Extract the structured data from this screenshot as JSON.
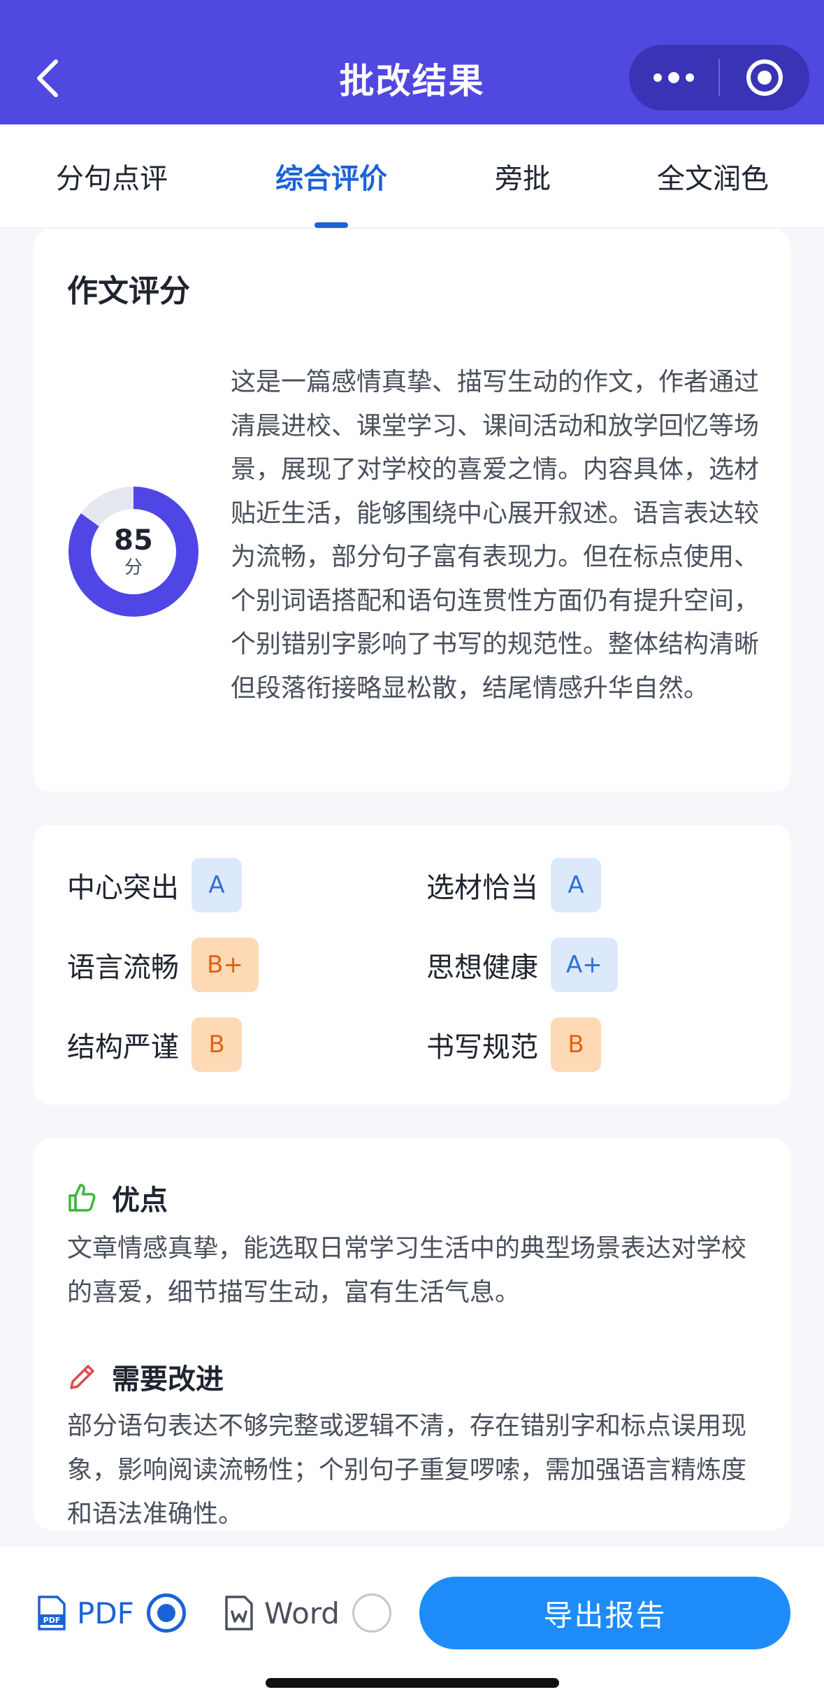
{
  "header": {
    "title": "批改结果",
    "back_icon": "chevron-left-icon",
    "more_icon": "more-dots-icon",
    "close_icon": "target-close-icon"
  },
  "tabs": [
    {
      "label": "分句点评",
      "active": false
    },
    {
      "label": "综合评价",
      "active": true
    },
    {
      "label": "旁批",
      "active": false
    },
    {
      "label": "全文润色",
      "active": false
    }
  ],
  "score_card": {
    "title": "作文评分",
    "score": "85",
    "score_unit": "分",
    "score_fraction": 0.85,
    "summary": "这是一篇感情真挚、描写生动的作文，作者通过清晨进校、课堂学习、课间活动和放学回忆等场景，展现了对学校的喜爱之情。内容具体，选材贴近生活，能够围绕中心展开叙述。语言表达较为流畅，部分句子富有表现力。但在标点使用、个别词语搭配和语句连贯性方面仍有提升空间，个别错别字影响了书写的规范性。整体结构清晰但段落衔接略显松散，结尾情感升华自然。"
  },
  "grades": [
    {
      "name": "中心突出",
      "grade": "A",
      "tone": "blue"
    },
    {
      "name": "选材恰当",
      "grade": "A",
      "tone": "blue"
    },
    {
      "name": "语言流畅",
      "grade": "B+",
      "tone": "orange"
    },
    {
      "name": "思想健康",
      "grade": "A+",
      "tone": "blue"
    },
    {
      "name": "结构严谨",
      "grade": "B",
      "tone": "orange"
    },
    {
      "name": "书写规范",
      "grade": "B",
      "tone": "orange"
    }
  ],
  "feedback": {
    "strengths_title": "优点",
    "strengths_text": "文章情感真挚，能选取日常学习生活中的典型场景表达对学校的喜爱，细节描写生动，富有生活气息。",
    "improve_title": "需要改进",
    "improve_text": "部分语句表达不够完整或逻辑不清，存在错别字和标点误用现象，影响阅读流畅性；个别句子重复啰嗦，需加强语言精炼度和语法准确性。"
  },
  "export": {
    "pdf_label": "PDF",
    "word_label": "Word",
    "selected_format": "PDF",
    "button_label": "导出报告"
  },
  "colors": {
    "header_bg": "#5148e0",
    "accent_blue": "#1a63d6",
    "donut_fill": "#4f46e5",
    "donut_track": "#e5e8ee",
    "export_button": "#1d8cf8",
    "badge_orange_text": "#e2620f",
    "badge_blue_text": "#2f6fd8",
    "strength_icon": "#3fb53f",
    "improve_icon": "#e04b4b"
  }
}
